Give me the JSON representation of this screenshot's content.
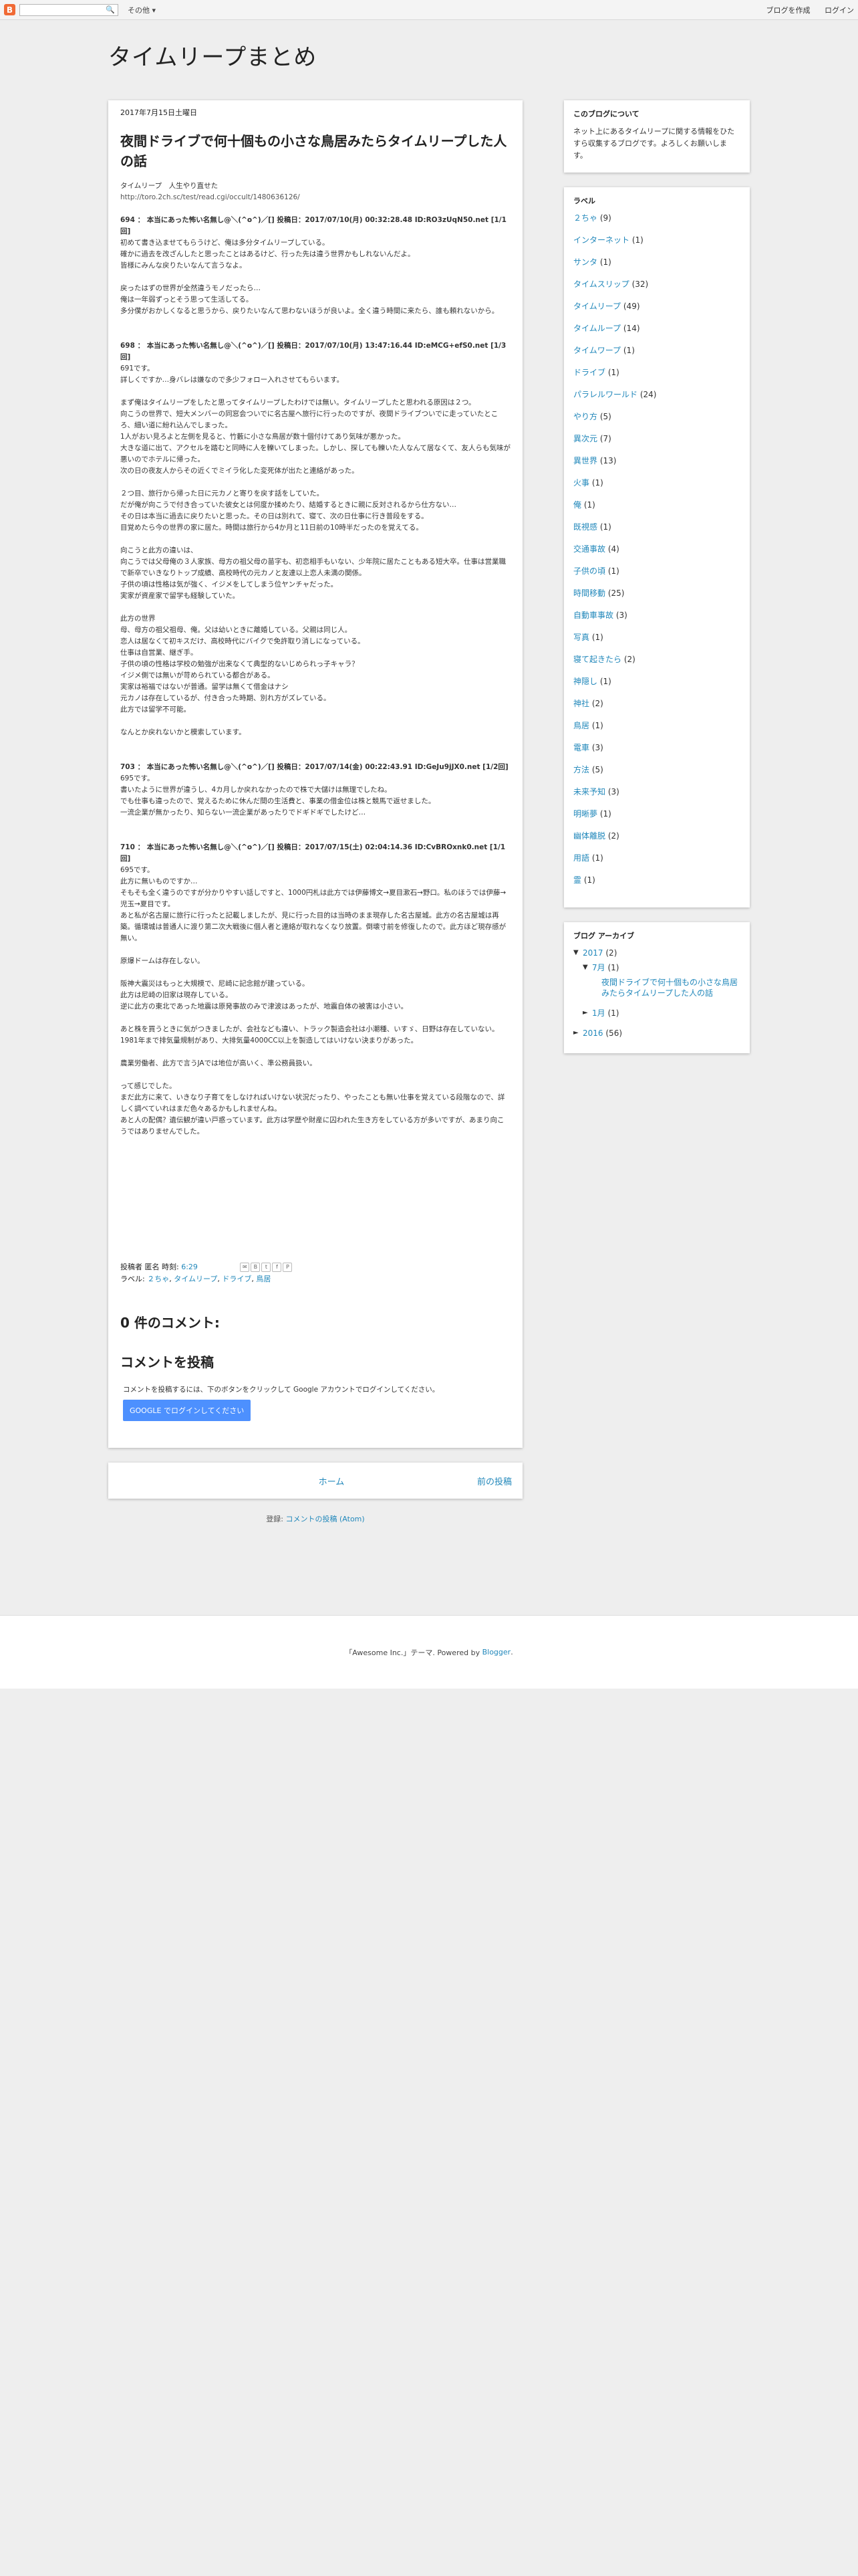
{
  "navbar": {
    "logo": "B",
    "search_icon": "🔍",
    "more": "その他 ▾",
    "create_blog": "ブログを作成",
    "login": "ログイン"
  },
  "blog": {
    "title": "タイムリープまとめ"
  },
  "post": {
    "date": "2017年7月15日土曜日",
    "title": "夜間ドライブで何十個もの小さな鳥居みたらタイムリープした人の話",
    "source_name": "タイムリープ　人生やり直せた",
    "source_url": "http://toro.2ch.sc/test/read.cgi/occult/1480636126/",
    "sections": [
      {
        "header": "694 ： 本当にあった怖い名無し@＼(^o^)／[] 投稿日：2017/07/10(月) 00:32:28.48 ID:RO3zUqN50.net [1/1回]",
        "paras": [
          [
            "初めて書き込ませてもらうけど、俺は多分タイムリープしている。",
            "確かに過去を改ざんしたと思ったことはあるけど、行った先は違う世界かもしれないんだよ。",
            "皆様にみんな戻りたいなんて言うなよ。"
          ],
          [
            "戻ったはずの世界が全然違うモノだったら…",
            "俺は一年弱ずっとそう思って生活してる。",
            "多分僕がおかしくなると思うから、戻りたいなんて思わないほうが良いよ。全く違う時間に来たら、誰も頼れないから。"
          ]
        ]
      },
      {
        "header": "698 ： 本当にあった怖い名無し@＼(^o^)／[] 投稿日：2017/07/10(月) 13:47:16.44 ID:eMCG+efS0.net [1/3回]",
        "paras": [
          [
            "691です。",
            "詳しくですか…身バレは嫌なので多少フォロー入れさせてもらいます。"
          ],
          [
            "まず俺はタイムリープをしたと思ってタイムリープしたわけでは無い。タイムリープしたと思われる原因は２つ。",
            "向こうの世界で、短大メンバーの同窓会ついでに名古屋へ旅行に行ったのですが、夜間ドライブついでに走っていたところ、細い道に紛れ込んでしまった。",
            "1人がおい見ろよと左側を見ると、竹藪に小さな鳥居が数十個付けてあり気味が悪かった。",
            "大きな道に出て、アクセルを踏むと同時に人を轢いてしまった。しかし、探しても轢いた人なんて居なくて、友人らも気味が悪いのでホテルに帰った。",
            "次の日の夜友人からその近くでミイラ化した変死体が出たと連絡があった。"
          ],
          [
            "２つ目、旅行から帰った日に元カノと寄りを戻す話をしていた。",
            "だが俺が向こうで付き合っていた彼女とは何度か揉めたり、結婚するときに親に反対されるから仕方ない…",
            "その日は本当に過去に戻りたいと思った。その日は別れて、寝て、次の日仕事に行き普段をする。",
            "目覚めたら今の世界の家に居た。時間は旅行から4か月と11日前の10時半だったのを覚えてる。"
          ],
          [
            "向こうと此方の違いは、",
            "向こうでは父母俺の３人家族、母方の祖父母の苗字も、初恋相手もいない、少年院に居たこともある短大卒。仕事は営業職で新卒でいきなりトップ成績、高校時代の元カノと友達以上恋人未満の関係。",
            "子供の頃は性格は気が強く、イジメをしてしまう位ヤンチャだった。",
            "実家が資産家で留学も経験していた。"
          ],
          [
            "此方の世界",
            "母、母方の祖父祖母、俺。父は幼いときに離婚している。父親は同じ人。",
            "恋人は居なくて初キスだけ、高校時代にバイクで免許取り消しになっている。",
            "仕事は自営業、継ぎ手。",
            "子供の頃の性格は学校の勉強が出来なくて典型的ないじめられっ子キャラ？",
            "イジメ側では無いが苛められている都合がある。",
            "実家は裕福ではないが普通。留学は無くて借金はナシ",
            "元カノは存在しているが、付き合った時期、別れ方がズレている。",
            "此方では留学不可能。"
          ],
          [
            "なんとか戻れないかと模索しています。"
          ]
        ]
      },
      {
        "header": "703 ： 本当にあった怖い名無し@＼(^o^)／[] 投稿日：2017/07/14(金) 00:22:43.91 ID:GeJu9jJX0.net [1/2回]",
        "paras": [
          [
            "695です。",
            "書いたように世界が違うし、4カ月しか戻れなかったので株で大儲けは無理でしたね。",
            "でも仕事も違ったので、覚えるために休んだ間の生活費と、事業の借金位は株と競馬で返せました。",
            "一流企業が無かったり、知らない一流企業があったりでドギドギでしたけど…"
          ]
        ]
      },
      {
        "header": "710 ： 本当にあった怖い名無し@＼(^o^)／[] 投稿日：2017/07/15(土) 02:04:14.36 ID:CvBROxnk0.net [1/1回]",
        "paras": [
          [
            "695です。",
            "此方に無いものですか…",
            "そもそも全く違うのですが分かりやすい話しですと、1000円札は此方では伊藤博文→夏目漱石→野口。私のほうでは伊藤→児玉→夏目です。",
            "あと私が名古屋に旅行に行ったと記載しましたが、見に行った目的は当時のまま現存した名古屋城。此方の名古屋城は再築。循環城は普通人に渡り第二次大戦後に個人者と連絡が取れなくなり放置。倒壊寸前を修復したので。此方ほど現存感が無い。"
          ],
          [
            "原爆ドームは存在しない。"
          ],
          [
            "阪神大震災はもっと大規模で、尼崎に記念館が建っている。",
            "此方は尼崎の旧家は現存している。",
            "逆に此方の東北であった地震は原発事故のみで津波はあったが、地震自体の被害は小さい。"
          ],
          [
            "あと株を買うときに気がつきましたが、会社なども違い、トラック製造会社は小潮種、いすゞ、日野は存在していない。1981年まで排気量規制があり、大排気量4000CC以上を製造してはいけない決まりがあった。"
          ],
          [
            "農業労働者、此方で言うJAでは地位が高いく、準公務員扱い。"
          ],
          [
            "って感じでした。",
            "まだ此方に来て、いきなり子育てをしなければいけない状況だったり、やったことも無い仕事を覚えている段階なので、詳しく調べていれはまだ色々あるかもしれませんね。",
            "あと人の配偶？遺伝観が違い戸惑っています。此方は学歴や財産に囚われた生き方をしている方が多いですが、あまり向こうではありませんでした。"
          ]
        ]
      }
    ],
    "footer": {
      "author_label": "投稿者 匿名 時刻:",
      "time": "6:29",
      "share_icons": [
        "✉",
        "B",
        "t",
        "f",
        "P"
      ],
      "labels_prefix": "ラベル:",
      "labels": [
        "２ちゃ",
        "タイムリープ",
        "ドライブ",
        "鳥居"
      ]
    }
  },
  "comments": {
    "count_title": "0 件のコメント:",
    "post_title": "コメントを投稿",
    "note": "コメントを投稿するには、下のボタンをクリックして Google アカウントでログインしてください。",
    "signin_button": "GOOGLE でログインしてください"
  },
  "pager": {
    "home": "ホーム",
    "older": "前の投稿"
  },
  "subscribe": {
    "label": "登録:",
    "link": "コメントの投稿 (Atom)"
  },
  "sidebar": {
    "about_title": "このブログについて",
    "about_text": "ネット上にあるタイムリープに関する情報をひたすら収集するブログです。よろしくお願いします。",
    "labels_title": "ラベル",
    "labels": [
      {
        "name": "２ちゃ",
        "count": "(9)"
      },
      {
        "name": "インターネット",
        "count": "(1)"
      },
      {
        "name": "サンタ",
        "count": "(1)"
      },
      {
        "name": "タイムスリップ",
        "count": "(32)"
      },
      {
        "name": "タイムリープ",
        "count": "(49)"
      },
      {
        "name": "タイムループ",
        "count": "(14)"
      },
      {
        "name": "タイムワープ",
        "count": "(1)"
      },
      {
        "name": "ドライブ",
        "count": "(1)"
      },
      {
        "name": "パラレルワールド",
        "count": "(24)"
      },
      {
        "name": "やり方",
        "count": "(5)"
      },
      {
        "name": "異次元",
        "count": "(7)"
      },
      {
        "name": "異世界",
        "count": "(13)"
      },
      {
        "name": "火事",
        "count": "(1)"
      },
      {
        "name": "俺",
        "count": "(1)"
      },
      {
        "name": "既視感",
        "count": "(1)"
      },
      {
        "name": "交通事故",
        "count": "(4)"
      },
      {
        "name": "子供の頃",
        "count": "(1)"
      },
      {
        "name": "時間移動",
        "count": "(25)"
      },
      {
        "name": "自動車事故",
        "count": "(3)"
      },
      {
        "name": "写真",
        "count": "(1)"
      },
      {
        "name": "寝て起きたら",
        "count": "(2)"
      },
      {
        "name": "神隠し",
        "count": "(1)"
      },
      {
        "name": "神社",
        "count": "(2)"
      },
      {
        "name": "鳥居",
        "count": "(1)"
      },
      {
        "name": "電車",
        "count": "(3)"
      },
      {
        "name": "方法",
        "count": "(5)"
      },
      {
        "name": "未来予知",
        "count": "(3)"
      },
      {
        "name": "明晰夢",
        "count": "(1)"
      },
      {
        "name": "幽体離脱",
        "count": "(2)"
      },
      {
        "name": "用語",
        "count": "(1)"
      },
      {
        "name": "霊",
        "count": "(1)"
      }
    ],
    "archive_title": "ブログ アーカイブ",
    "archive": {
      "year1": {
        "toggle": "▼",
        "name": "2017",
        "count": "(2)"
      },
      "month1": {
        "toggle": "▼",
        "name": "7月",
        "count": "(1)"
      },
      "post1": "夜間ドライブで何十個もの小さな鳥居みたらタイムリープした人の話",
      "month2": {
        "toggle": "►",
        "name": "1月",
        "count": "(1)"
      },
      "year2": {
        "toggle": "►",
        "name": "2016",
        "count": "(56)"
      }
    }
  },
  "site_footer": {
    "text": "「Awesome Inc.」テーマ. Powered by",
    "link": "Blogger",
    "end": "."
  }
}
